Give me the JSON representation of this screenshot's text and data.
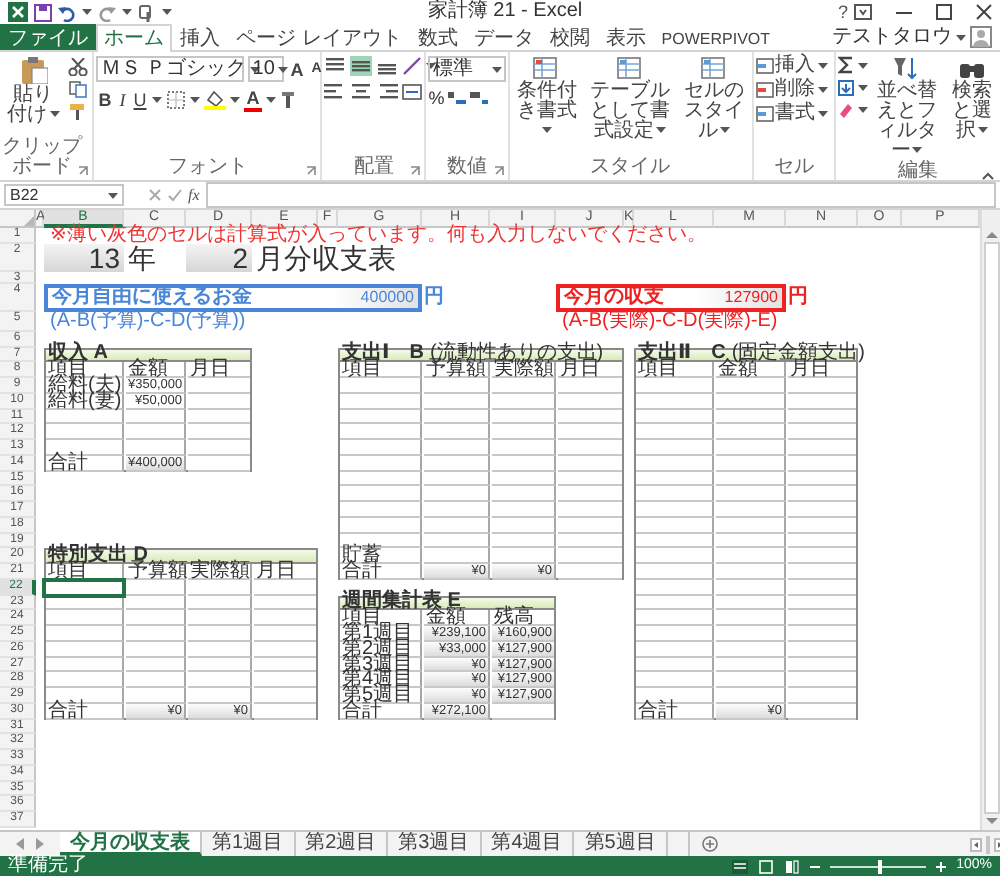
{
  "window": {
    "title": "家計簿 21 - Excel",
    "help": "?"
  },
  "ribbon_tabs": [
    {
      "label": "ファイル",
      "kind": "file",
      "selected": false
    },
    {
      "label": "ホーム",
      "kind": "tab",
      "selected": true
    },
    {
      "label": "挿入",
      "kind": "tab",
      "selected": false
    },
    {
      "label": "ページ レイアウト",
      "kind": "tab",
      "selected": false
    },
    {
      "label": "数式",
      "kind": "tab",
      "selected": false
    },
    {
      "label": "データ",
      "kind": "tab",
      "selected": false
    },
    {
      "label": "校閲",
      "kind": "tab",
      "selected": false
    },
    {
      "label": "表示",
      "kind": "tab",
      "selected": false
    },
    {
      "label": "POWERPIVOT",
      "kind": "tab",
      "selected": false
    }
  ],
  "user": {
    "name": "テストタロウ"
  },
  "ribbon": {
    "clipboard": {
      "label": "クリップボード",
      "paste": "貼り付け"
    },
    "font": {
      "label": "フォント",
      "name": "ＭＳ Ｐゴシック",
      "size": "10",
      "size_buttons": [
        "A",
        "A"
      ],
      "style_buttons": [
        "B",
        "I",
        "U"
      ],
      "color_button": "A"
    },
    "alignment": {
      "label": "配置",
      "vertical_align": [
        {
          "selected": false
        },
        {
          "selected": true
        },
        {
          "selected": false
        }
      ]
    },
    "number": {
      "label": "数値",
      "format": "標準",
      "percent": "%"
    },
    "styles": {
      "label": "スタイル",
      "buttons": [
        "条件付き書式",
        "テーブルとして書式設定",
        "セルのスタイル"
      ]
    },
    "cells": {
      "label": "セル",
      "buttons": [
        "挿入",
        "削除",
        "書式"
      ]
    },
    "editing": {
      "label": "編集",
      "buttons": [
        "並べ替えとフィルター",
        "検索と選択"
      ]
    }
  },
  "formula_bar": {
    "name_box": "B22",
    "function_label": "fx"
  },
  "sheet": {
    "columns": [
      {
        "label": "A",
        "selected": false
      },
      {
        "label": "B",
        "selected": true
      },
      {
        "label": "C",
        "selected": false
      },
      {
        "label": "D",
        "selected": false
      },
      {
        "label": "E",
        "selected": false
      },
      {
        "label": "F",
        "selected": false
      },
      {
        "label": "G",
        "selected": false
      },
      {
        "label": "H",
        "selected": false
      },
      {
        "label": "I",
        "selected": false
      },
      {
        "label": "J",
        "selected": false
      },
      {
        "label": "K",
        "selected": false
      },
      {
        "label": "L",
        "selected": false
      },
      {
        "label": "M",
        "selected": false
      },
      {
        "label": "N",
        "selected": false
      },
      {
        "label": "O",
        "selected": false
      },
      {
        "label": "P",
        "selected": false
      }
    ],
    "rows": [
      {
        "label": "1",
        "selected": false
      },
      {
        "label": "2",
        "selected": false
      },
      {
        "label": "3",
        "selected": false
      },
      {
        "label": "4",
        "selected": false
      },
      {
        "label": "5",
        "selected": false
      },
      {
        "label": "6",
        "selected": false
      },
      {
        "label": "7",
        "selected": false
      },
      {
        "label": "8",
        "selected": false
      },
      {
        "label": "9",
        "selected": false
      },
      {
        "label": "10",
        "selected": false
      },
      {
        "label": "11",
        "selected": false
      },
      {
        "label": "12",
        "selected": false
      },
      {
        "label": "13",
        "selected": false
      },
      {
        "label": "14",
        "selected": false
      },
      {
        "label": "15",
        "selected": false
      },
      {
        "label": "16",
        "selected": false
      },
      {
        "label": "17",
        "selected": false
      },
      {
        "label": "18",
        "selected": false
      },
      {
        "label": "19",
        "selected": false
      },
      {
        "label": "20",
        "selected": false
      },
      {
        "label": "21",
        "selected": false
      },
      {
        "label": "22",
        "selected": true
      },
      {
        "label": "23",
        "selected": false
      },
      {
        "label": "24",
        "selected": false
      },
      {
        "label": "25",
        "selected": false
      },
      {
        "label": "26",
        "selected": false
      },
      {
        "label": "27",
        "selected": false
      },
      {
        "label": "28",
        "selected": false
      },
      {
        "label": "29",
        "selected": false
      },
      {
        "label": "30",
        "selected": false
      },
      {
        "label": "31",
        "selected": false
      },
      {
        "label": "32",
        "selected": false
      },
      {
        "label": "33",
        "selected": false
      },
      {
        "label": "34",
        "selected": false
      },
      {
        "label": "35",
        "selected": false
      },
      {
        "label": "36",
        "selected": false
      },
      {
        "label": "37",
        "selected": false
      }
    ],
    "notice": "※薄い灰色のセルは計算式が入っています。何も入力しないでください。",
    "period": {
      "year": "13",
      "year_unit": "年",
      "month": "2",
      "title": "月分収支表"
    },
    "summaries": [
      {
        "label": "今月自由に使えるお金",
        "value": "400000",
        "unit": "円",
        "formula": "(A-B(予算)-C-D(予算))",
        "color": "#4a86d8"
      },
      {
        "label": "今月の収支",
        "value": "127900",
        "unit": "円",
        "formula": "(A-B(実際)-C-D(実際)-E)",
        "color": "#ee2222"
      }
    ],
    "tables": [
      {
        "title": "収入 A",
        "columns": [
          "項目",
          "金額",
          "月日"
        ],
        "rows": [
          {
            "cells": [
              {
                "text": "給料(夫)",
                "calculated": false
              },
              {
                "text": "¥350,000",
                "calculated": false
              },
              null
            ]
          },
          {
            "cells": [
              {
                "text": "給料(妻)",
                "calculated": false
              },
              {
                "text": "¥50,000",
                "calculated": false
              },
              null
            ]
          },
          {
            "cells": [
              null,
              null,
              null
            ]
          },
          {
            "cells": [
              null,
              null,
              null
            ]
          },
          {
            "cells": [
              null,
              null,
              null
            ]
          },
          {
            "cells": [
              {
                "text": "合計",
                "calculated": false
              },
              {
                "text": "¥400,000",
                "calculated": true
              },
              null
            ]
          }
        ]
      },
      {
        "title": "特別支出 D",
        "columns": [
          "項目",
          "予算額",
          "実際額",
          "月日"
        ],
        "rows": [
          {
            "cells": [
              null,
              null,
              null,
              null
            ]
          },
          {
            "cells": [
              null,
              null,
              null,
              null
            ]
          },
          {
            "cells": [
              null,
              null,
              null,
              null
            ]
          },
          {
            "cells": [
              null,
              null,
              null,
              null
            ]
          },
          {
            "cells": [
              null,
              null,
              null,
              null
            ]
          },
          {
            "cells": [
              null,
              null,
              null,
              null
            ]
          },
          {
            "cells": [
              null,
              null,
              null,
              null
            ]
          },
          {
            "cells": [
              null,
              null,
              null,
              null
            ]
          },
          {
            "cells": [
              {
                "text": "合計",
                "calculated": false
              },
              {
                "text": "¥0",
                "calculated": true
              },
              {
                "text": "¥0",
                "calculated": true
              },
              null
            ]
          }
        ]
      },
      {
        "title": "支出Ⅰ　B",
        "note": "(流動性ありの支出)",
        "columns": [
          "項目",
          "予算額",
          "実際額",
          "月日"
        ],
        "rows": [
          {
            "cells": [
              null,
              null,
              null,
              null
            ]
          },
          {
            "cells": [
              null,
              null,
              null,
              null
            ]
          },
          {
            "cells": [
              null,
              null,
              null,
              null
            ]
          },
          {
            "cells": [
              null,
              null,
              null,
              null
            ]
          },
          {
            "cells": [
              null,
              null,
              null,
              null
            ]
          },
          {
            "cells": [
              null,
              null,
              null,
              null
            ]
          },
          {
            "cells": [
              null,
              null,
              null,
              null
            ]
          },
          {
            "cells": [
              null,
              null,
              null,
              null
            ]
          },
          {
            "cells": [
              null,
              null,
              null,
              null
            ]
          },
          {
            "cells": [
              null,
              null,
              null,
              null
            ]
          },
          {
            "cells": [
              null,
              null,
              null,
              null
            ]
          },
          {
            "cells": [
              {
                "text": "貯蓄",
                "calculated": false
              },
              null,
              null,
              null
            ]
          },
          {
            "cells": [
              {
                "text": "合計",
                "calculated": false
              },
              {
                "text": "¥0",
                "calculated": true
              },
              {
                "text": "¥0",
                "calculated": true
              },
              null
            ]
          }
        ]
      },
      {
        "title": "週間集計表 E",
        "columns": [
          "項目",
          "金額",
          "残高"
        ],
        "rows": [
          {
            "cells": [
              {
                "text": "第1週目",
                "calculated": false
              },
              {
                "text": "¥239,100",
                "calculated": true
              },
              {
                "text": "¥160,900",
                "calculated": true
              }
            ]
          },
          {
            "cells": [
              {
                "text": "第2週目",
                "calculated": false
              },
              {
                "text": "¥33,000",
                "calculated": true
              },
              {
                "text": "¥127,900",
                "calculated": true
              }
            ]
          },
          {
            "cells": [
              {
                "text": "第3週目",
                "calculated": false
              },
              {
                "text": "¥0",
                "calculated": true
              },
              {
                "text": "¥127,900",
                "calculated": true
              }
            ]
          },
          {
            "cells": [
              {
                "text": "第4週目",
                "calculated": false
              },
              {
                "text": "¥0",
                "calculated": true
              },
              {
                "text": "¥127,900",
                "calculated": true
              }
            ]
          },
          {
            "cells": [
              {
                "text": "第5週目",
                "calculated": false
              },
              {
                "text": "¥0",
                "calculated": true
              },
              {
                "text": "¥127,900",
                "calculated": true
              }
            ]
          },
          {
            "cells": [
              {
                "text": "合計",
                "calculated": false
              },
              {
                "text": "¥272,100",
                "calculated": true
              },
              null
            ]
          }
        ]
      },
      {
        "title": "支出Ⅱ　C",
        "note": "(固定金額支出)",
        "columns": [
          "項目",
          "金額",
          "月日"
        ],
        "rows": [
          {
            "cells": [
              null,
              null,
              null
            ]
          },
          {
            "cells": [
              null,
              null,
              null
            ]
          },
          {
            "cells": [
              null,
              null,
              null
            ]
          },
          {
            "cells": [
              null,
              null,
              null
            ]
          },
          {
            "cells": [
              null,
              null,
              null
            ]
          },
          {
            "cells": [
              null,
              null,
              null
            ]
          },
          {
            "cells": [
              null,
              null,
              null
            ]
          },
          {
            "cells": [
              null,
              null,
              null
            ]
          },
          {
            "cells": [
              null,
              null,
              null
            ]
          },
          {
            "cells": [
              null,
              null,
              null
            ]
          },
          {
            "cells": [
              null,
              null,
              null
            ]
          },
          {
            "cells": [
              null,
              null,
              null
            ]
          },
          {
            "cells": [
              null,
              null,
              null
            ]
          },
          {
            "cells": [
              null,
              null,
              null
            ]
          },
          {
            "cells": [
              null,
              null,
              null
            ]
          },
          {
            "cells": [
              null,
              null,
              null
            ]
          },
          {
            "cells": [
              null,
              null,
              null
            ]
          },
          {
            "cells": [
              null,
              null,
              null
            ]
          },
          {
            "cells": [
              null,
              null,
              null
            ]
          },
          {
            "cells": [
              null,
              null,
              null
            ]
          },
          {
            "cells": [
              null,
              null,
              null
            ]
          },
          {
            "cells": [
              {
                "text": "合計",
                "calculated": false
              },
              {
                "text": "¥0",
                "calculated": true
              },
              null
            ]
          }
        ]
      }
    ]
  },
  "sheet_tabs": [
    {
      "label": "今月の収支表",
      "selected": true
    },
    {
      "label": "第1週目",
      "selected": false
    },
    {
      "label": "第2週目",
      "selected": false
    },
    {
      "label": "第3週目",
      "selected": false
    },
    {
      "label": "第4週目",
      "selected": false
    },
    {
      "label": "第5週目",
      "selected": false
    }
  ],
  "status_bar": {
    "text": "準備完了",
    "zoom": "100%",
    "zoom_slider": {
      "level": 0.5
    }
  }
}
